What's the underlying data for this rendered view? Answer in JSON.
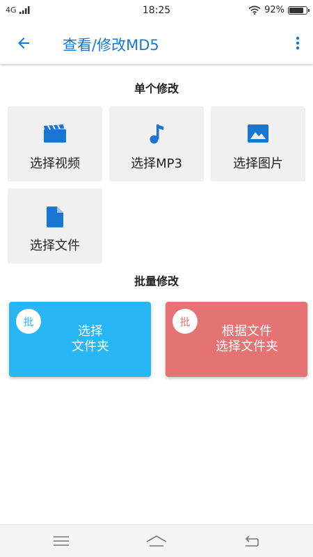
{
  "status_bar": {
    "network": "4G",
    "time": "18:25",
    "battery": "92%",
    "battery_level": 0.92
  },
  "app_bar": {
    "title": "查看/修改MD5",
    "back_icon": "arrow-back-icon",
    "menu_icon": "more-vert-icon"
  },
  "single_section": {
    "title": "单个修改",
    "tiles": [
      {
        "label": "选择视频",
        "icon": "movie-clapperboard-icon"
      },
      {
        "label": "选择MP3",
        "icon": "music-note-icon"
      },
      {
        "label": "选择图片",
        "icon": "image-icon"
      },
      {
        "label": "选择文件",
        "icon": "file-icon"
      }
    ]
  },
  "batch_section": {
    "title": "批量修改",
    "cards": [
      {
        "badge": "批",
        "line1": "选择",
        "line2": "文件夹",
        "color": "#29b6f6"
      },
      {
        "badge": "批",
        "line1": "根据文件",
        "line2": "选择文件夹",
        "color": "#e57373"
      }
    ]
  },
  "colors": {
    "accent": "#1976d2",
    "tile_bg": "#f0f0f0"
  },
  "nav_bar": {
    "icons": [
      "menu-icon",
      "home-icon",
      "back-icon"
    ]
  }
}
